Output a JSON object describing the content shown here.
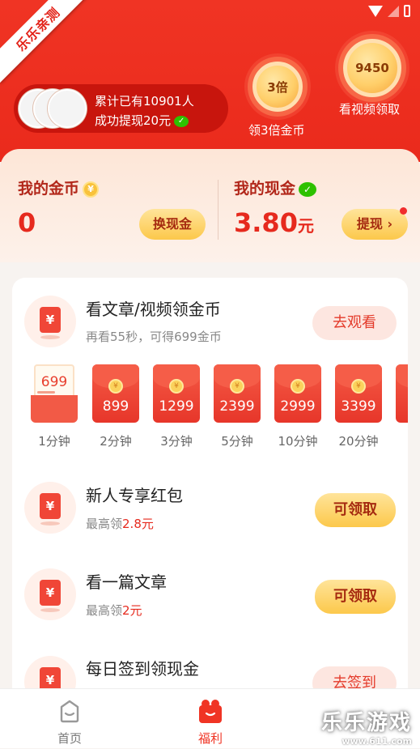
{
  "ribbon": "乐乐亲测",
  "counter": {
    "line1": "累计已有10901人",
    "line2": "成功提现20元"
  },
  "bonus": [
    {
      "coin": "3倍",
      "label": "领3倍金币"
    },
    {
      "coin": "9450",
      "label": "看视频领取"
    }
  ],
  "wallet": {
    "gold": {
      "label": "我的金币",
      "value": "0",
      "btn": "换现金"
    },
    "cash": {
      "label": "我的现金",
      "value": "3.80",
      "unit": "元",
      "btn": "提现 ›"
    }
  },
  "tasks": [
    {
      "title": "看文章/视频领金币",
      "sub": "再看55秒，可得699金币",
      "btn": "去观看"
    },
    {
      "title": "新人专享红包",
      "sub_prefix": "最高领",
      "sub_amt": "2.8元",
      "btn": "可领取"
    },
    {
      "title": "看一篇文章",
      "sub_prefix": "最高领",
      "sub_amt": "2元",
      "btn": "可领取"
    },
    {
      "title": "每日签到领现金",
      "btn": "去签到"
    }
  ],
  "rewards": [
    {
      "value": "699",
      "time": "1分钟"
    },
    {
      "value": "899",
      "time": "2分钟"
    },
    {
      "value": "1299",
      "time": "3分钟"
    },
    {
      "value": "2399",
      "time": "5分钟"
    },
    {
      "value": "2999",
      "time": "10分钟"
    },
    {
      "value": "3399",
      "time": "20分钟"
    }
  ],
  "tabs": [
    {
      "label": "首页"
    },
    {
      "label": "福利"
    }
  ],
  "watermark": {
    "main": "乐乐游戏",
    "sub": "www.611.com"
  },
  "colors": {
    "primary": "#ea2a1c",
    "accent_yellow": "#fcc84b"
  }
}
